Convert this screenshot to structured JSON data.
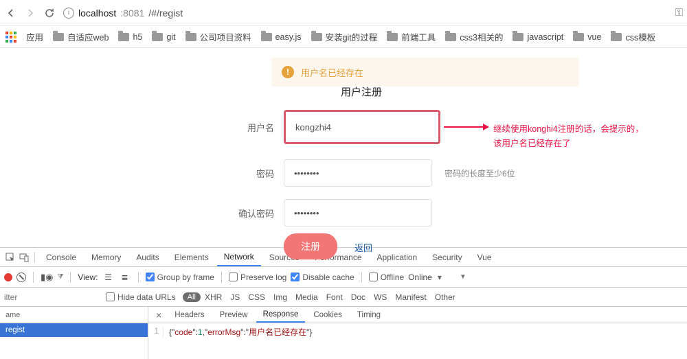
{
  "chrome": {
    "url_host": "localhost",
    "url_port": ":8081",
    "url_path": "/#/regist",
    "apps_label": "应用"
  },
  "bookmarks": [
    "自适应web",
    "h5",
    "git",
    "公司项目资料",
    "easy.js",
    "安装git的过程",
    "前端工具",
    "css3相关的",
    "javascript",
    "vue",
    "css模板"
  ],
  "page": {
    "alert_text": "用户名已经存在",
    "title": "用户注册",
    "username_label": "用户名",
    "username_value": "kongzhi4",
    "password_label": "密码",
    "password_value": "••••••••",
    "password_hint": "密码的长度至少6位",
    "confirm_label": "确认密码",
    "confirm_value": "••••••••",
    "submit_label": "注册",
    "back_label": "返回",
    "annotation_line1": "继续使用konghi4注册的话，会提示的，",
    "annotation_line2": "该用户名已经存在了"
  },
  "devtools": {
    "tabs": [
      "Console",
      "Memory",
      "Audits",
      "Elements",
      "Network",
      "Sources",
      "Performance",
      "Application",
      "Security",
      "Vue"
    ],
    "active_tab": "Network",
    "toolbar": {
      "view_label": "View:",
      "group_by_frame": "Group by frame",
      "preserve_log": "Preserve log",
      "disable_cache": "Disable cache",
      "offline": "Offline",
      "online": "Online"
    },
    "filter": {
      "placeholder": "ilter",
      "hide_data_urls": "Hide data URLs",
      "all": "All",
      "types": [
        "XHR",
        "JS",
        "CSS",
        "Img",
        "Media",
        "Font",
        "Doc",
        "WS",
        "Manifest",
        "Other"
      ]
    },
    "requests": {
      "header": "ame",
      "items": [
        "regist"
      ]
    },
    "response": {
      "tabs": [
        "Headers",
        "Preview",
        "Response",
        "Cookies",
        "Timing"
      ],
      "active": "Response",
      "json_prefix1": "{\"",
      "json_key1": "code",
      "json_mid1": "\":",
      "json_num": "1",
      "json_mid2": ",\"",
      "json_key2": "errorMsg",
      "json_mid3": "\":\"",
      "json_str": "用户名已经存在",
      "json_suffix": "\"}"
    }
  }
}
